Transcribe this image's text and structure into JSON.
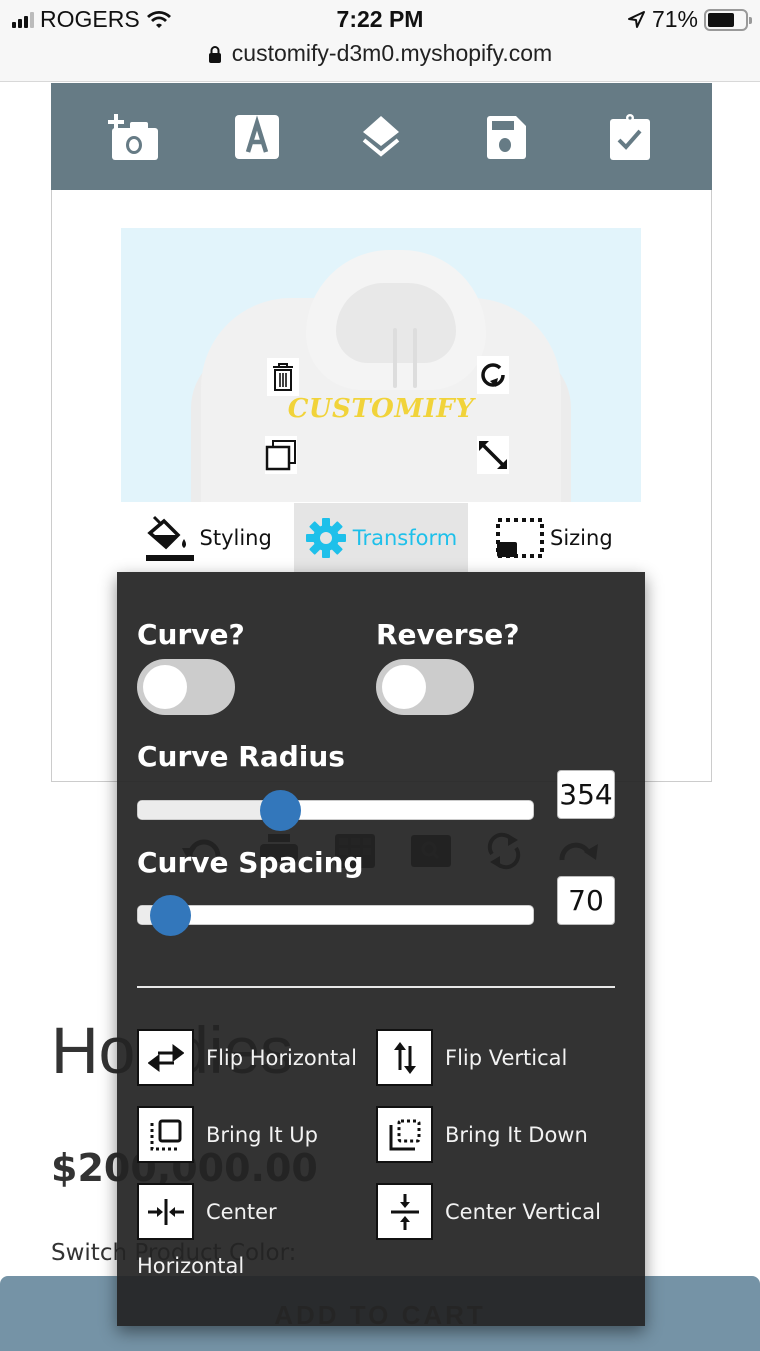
{
  "status_bar": {
    "carrier": "ROGERS",
    "time": "7:22 PM",
    "battery": "71%",
    "battery_level": 0.71,
    "url": "customify-d3m0.myshopify.com"
  },
  "toolbar": {
    "items": [
      {
        "name": "add-photo",
        "icon": "camera-plus-icon"
      },
      {
        "name": "add-text",
        "icon": "text-a-icon"
      },
      {
        "name": "layers",
        "icon": "layers-icon"
      },
      {
        "name": "save",
        "icon": "floppy-disk-icon"
      },
      {
        "name": "checkout",
        "icon": "clipboard-check-icon"
      }
    ],
    "color": "#667b85"
  },
  "canvas": {
    "text": "CUSTOMIFY",
    "text_color": "#f1d33a",
    "background": "#e2f4fb"
  },
  "tabs": [
    {
      "label": "Styling",
      "icon": "paint-bucket-icon",
      "active": false
    },
    {
      "label": "Transform",
      "icon": "gear-icon",
      "active": true
    },
    {
      "label": "Sizing",
      "icon": "resize-dashed-icon",
      "active": false
    }
  ],
  "panel": {
    "curve_label": "Curve?",
    "curve_on": false,
    "reverse_label": "Reverse?",
    "reverse_on": false,
    "radius_label": "Curve Radius",
    "radius_value": "354",
    "radius_fraction": 0.36,
    "spacing_label": "Curve Spacing",
    "spacing_value": "70",
    "spacing_fraction": 0.08,
    "actions": [
      {
        "label": "Flip Horizontal",
        "icon": "flip-horizontal-icon"
      },
      {
        "label": "Flip Vertical",
        "icon": "flip-vertical-icon"
      },
      {
        "label": "Bring It Up",
        "icon": "bring-forward-icon"
      },
      {
        "label": "Bring It Down",
        "icon": "send-backward-icon"
      },
      {
        "label": "Center",
        "icon": "center-horizontal-icon"
      },
      {
        "label": "Center Vertical",
        "icon": "center-vertical-icon"
      }
    ],
    "center_wrap": "Horizontal"
  },
  "background_tools": [
    "undo-icon",
    "print-icon",
    "grid-icon",
    "zoom-icon",
    "refresh-icon",
    "redo-icon"
  ],
  "product": {
    "title": "Hoodies",
    "price": "$200,000.00",
    "color_label": "Switch Product Color:",
    "cart_button": "ADD TO CART"
  },
  "colors": {
    "accent": "#1ec0ea",
    "slider_thumb": "#3377bb",
    "cart_bar": "#7593a6"
  }
}
